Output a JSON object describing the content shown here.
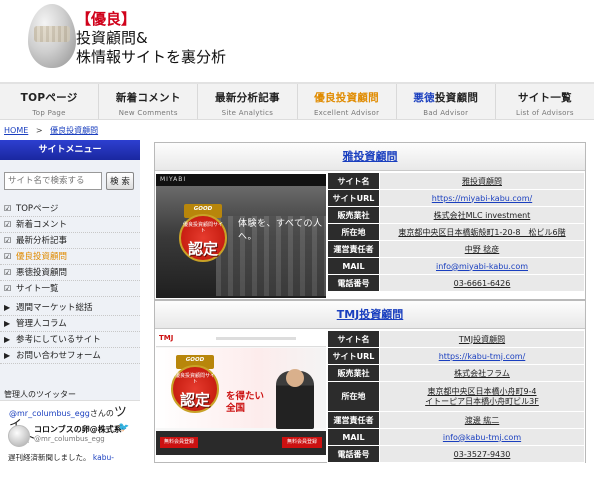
{
  "site": {
    "tag": "【優良】",
    "title_line1": "投資顧問&",
    "title_line2": "株情報サイトを裏分析"
  },
  "nav": [
    {
      "main": "TOPページ",
      "sub": "Top Page"
    },
    {
      "main": "新着コメント",
      "sub": "New Comments"
    },
    {
      "main": "最新分析記事",
      "sub": "Site Analytics"
    },
    {
      "main": "優良投資顧問",
      "sub": "Excellent Advisor"
    },
    {
      "main_highlight": "悪徳",
      "main_rest": "投資顧問",
      "sub": "Bad Advisor"
    },
    {
      "main": "サイト一覧",
      "sub": "List of Advisors"
    }
  ],
  "breadcrumb": {
    "home": "HOME",
    "sep": ">",
    "current": "優良投資顧問"
  },
  "sidebar": {
    "title": "サイトメニュー",
    "search_placeholder": "サイト名で検索する",
    "search_button": "検 索",
    "menu_checked": [
      "TOPページ",
      "新着コメント",
      "最新分析記事",
      "優良投資顧問",
      "悪徳投資顧問",
      "サイト一覧"
    ],
    "menu_arrow": [
      "週間マーケット総括",
      "管理人コラム",
      "参考にしているサイト",
      "お問い合わせフォーム"
    ],
    "twitter_label": "管理人のツイッター",
    "twitter_follow_handle": "@mr_columbus_egg",
    "twitter_follow_mid": "さんの",
    "twitter_follow_big": "ツイ",
    "twitter_follow_big2": "ート",
    "tweet_name": "コロンブスの卵@株式系",
    "tweet_handle": "@mr_columbus_egg",
    "tweet_text": "遅刊経済新聞しました。",
    "tweet_link": "kabu-"
  },
  "cards": [
    {
      "title": "雅投資顧問",
      "shot": {
        "brand": "MIYABI",
        "copy": "体験を、すべての人へ。"
      },
      "badge": {
        "ribbon": "GOOD",
        "top": "優良投資顧問サイト",
        "main": "認定"
      },
      "rows": [
        {
          "key": "サイト名",
          "value": "雅投資顧問"
        },
        {
          "key": "サイトURL",
          "value": "https://miyabi-kabu.com/"
        },
        {
          "key": "販売業社",
          "value": "株式会社MLC investment"
        },
        {
          "key": "所在地",
          "value": "東京都中央区日本橋蛎殻町1-20-8　松ビル6階"
        },
        {
          "key": "運営責任者",
          "value": "中野 稔彦"
        },
        {
          "key": "MAIL",
          "value": "info@miyabi-kabu.com"
        },
        {
          "key": "電話番号",
          "value": "03-6661-6426"
        }
      ]
    },
    {
      "title": "TMJ投資顧問",
      "shot": {
        "brand": "TMJ",
        "copy1": "を得たい",
        "copy2": "全国",
        "btn1": "無料会員登録",
        "btn2": "無料会員登録"
      },
      "badge": {
        "ribbon": "GOOD",
        "top": "優良投資顧問サイト",
        "main": "認定"
      },
      "rows": [
        {
          "key": "サイト名",
          "value": "TMJ投資顧問"
        },
        {
          "key": "サイトURL",
          "value": "https://kabu-tmj.com/"
        },
        {
          "key": "販売業社",
          "value": "株式会社フラム"
        },
        {
          "key": "所在地",
          "value_line1": "東京都中央区日本橋小舟町9-4",
          "value_line2": "イトーピア日本橋小舟町ビル3F"
        },
        {
          "key": "運営責任者",
          "value": "渡邊 紘二"
        },
        {
          "key": "MAIL",
          "value": "info@kabu-tmj.com"
        },
        {
          "key": "電話番号",
          "value": "03-3527-9430"
        }
      ]
    }
  ]
}
